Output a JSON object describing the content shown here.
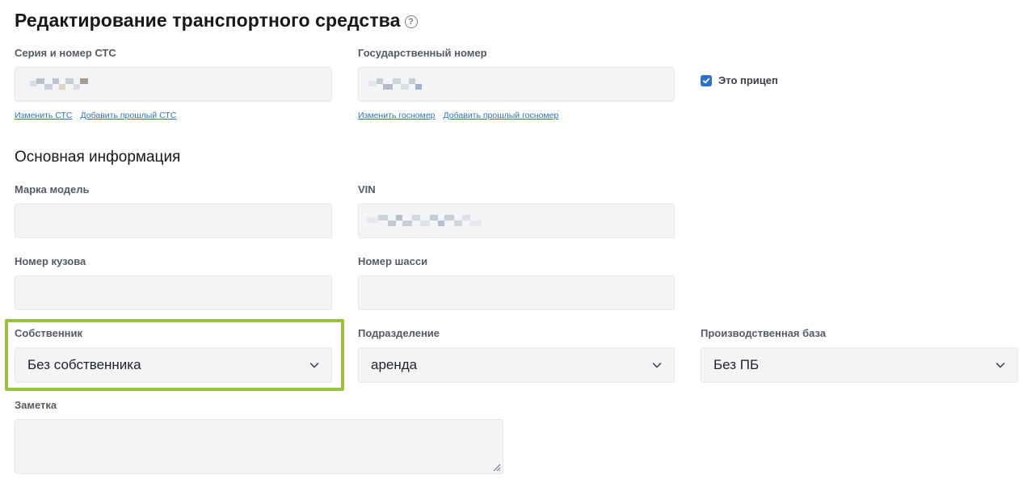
{
  "header": {
    "title": "Редактирование транспортного средства",
    "help_icon": "question-circle-icon"
  },
  "registration": {
    "sts_label": "Серия и номер СТС",
    "sts_links": [
      "Изменить СТС",
      "Добавить прошлый СТС"
    ],
    "plate_label": "Государственный номер",
    "plate_links": [
      "Изменить госномер",
      "Добавить прошлый госномер"
    ],
    "trailer_checkbox": {
      "label": "Это прицеп",
      "checked": true
    }
  },
  "main_info": {
    "section_title": "Основная информация",
    "make_model_label": "Марка модель",
    "vin_label": "VIN",
    "body_number_label": "Номер кузова",
    "chassis_number_label": "Номер шасси",
    "owner": {
      "label": "Собственник",
      "value": "Без собственника"
    },
    "division": {
      "label": "Подразделение",
      "value": "аренда"
    },
    "production_base": {
      "label": "Производственная база",
      "value": "Без ПБ"
    },
    "note_label": "Заметка"
  },
  "colors": {
    "accent": "#2b6fd1",
    "link": "#2b73c9",
    "highlight": "#9ac23c",
    "field_bg": "#f3f4f6"
  }
}
